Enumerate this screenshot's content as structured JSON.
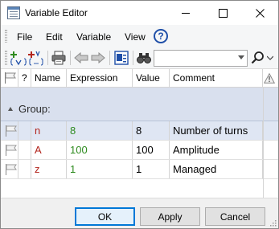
{
  "window": {
    "title": "Variable Editor",
    "app_icon": "table-icon",
    "controls": [
      "minimize-icon",
      "maximize-icon",
      "close-icon"
    ]
  },
  "menu": {
    "items": [
      {
        "label": "File"
      },
      {
        "label": "Edit"
      },
      {
        "label": "Variable"
      },
      {
        "label": "View"
      }
    ],
    "help_icon": "help-icon",
    "help_glyph": "?"
  },
  "toolbar": {
    "icons": [
      "add-variable-icon",
      "add-function-icon",
      "print-icon",
      "undo-icon",
      "redo-icon",
      "properties-icon",
      "find-icon",
      "search-icon"
    ],
    "search_value": "",
    "colors": {
      "add": "#2e8b1f",
      "function": "#b3261e",
      "arrows": "#8a8a8a"
    }
  },
  "grid": {
    "columns": [
      {
        "label": ""
      },
      {
        "label": "?"
      },
      {
        "label": "Name"
      },
      {
        "label": "Expression"
      },
      {
        "label": "Value"
      },
      {
        "label": "Comment"
      },
      {
        "label": ""
      }
    ],
    "header_icons": [
      "flag-icon",
      "warning-icon"
    ],
    "group_label": "Group:",
    "rows": [
      {
        "name": "n",
        "expression": "8",
        "value": "8",
        "comment": "Number of turns",
        "selected": true
      },
      {
        "name": "A",
        "expression": "100",
        "value": "100",
        "comment": "Amplitude",
        "selected": false
      },
      {
        "name": "z",
        "expression": "1",
        "value": "1",
        "comment": "Managed",
        "selected": false
      }
    ],
    "colors": {
      "name": "#b3261e",
      "expression": "#2e8b1f",
      "group_bg": "#d9e0ee",
      "selected_bg": "#dfe6f3"
    }
  },
  "footer": {
    "ok_label": "OK",
    "apply_label": "Apply",
    "cancel_label": "Cancel"
  }
}
